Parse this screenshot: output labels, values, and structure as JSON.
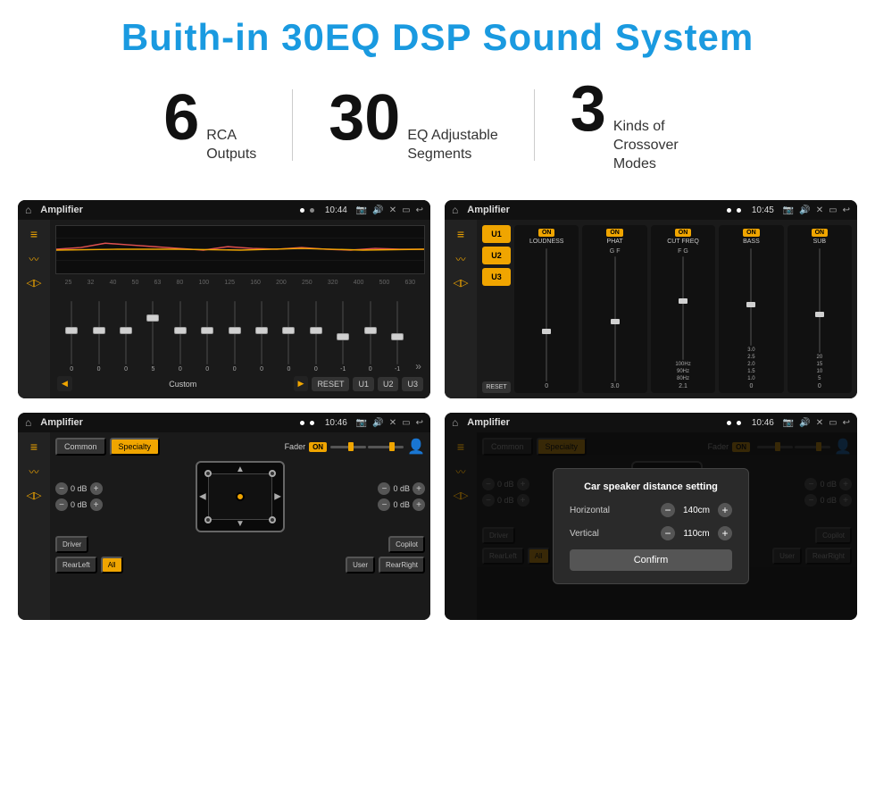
{
  "page": {
    "title": "Buith-in 30EQ DSP Sound System"
  },
  "stats": [
    {
      "number": "6",
      "label": "RCA\nOutputs"
    },
    {
      "number": "30",
      "label": "EQ Adjustable\nSegments"
    },
    {
      "number": "3",
      "label": "Kinds of\nCrossover Modes"
    }
  ],
  "screens": [
    {
      "id": "eq-screen",
      "title": "Amplifier",
      "time": "10:44",
      "type": "eq",
      "freqs": [
        "25",
        "32",
        "40",
        "50",
        "63",
        "80",
        "100",
        "125",
        "160",
        "200",
        "250",
        "320",
        "400",
        "500",
        "630"
      ],
      "values": [
        "0",
        "0",
        "0",
        "5",
        "0",
        "0",
        "0",
        "0",
        "0",
        "0",
        "-1",
        "0",
        "-1"
      ],
      "preset": "Custom",
      "buttons": [
        "RESET",
        "U1",
        "U2",
        "U3"
      ]
    },
    {
      "id": "crossover-screen",
      "title": "Amplifier",
      "time": "10:45",
      "type": "crossover",
      "channels": [
        "U1",
        "U2",
        "U3"
      ],
      "panels": [
        {
          "toggle": "ON",
          "title": "LOUDNESS"
        },
        {
          "toggle": "ON",
          "title": "PHAT"
        },
        {
          "toggle": "ON",
          "title": "CUT FREQ"
        },
        {
          "toggle": "ON",
          "title": "BASS"
        },
        {
          "toggle": "ON",
          "title": "SUB"
        }
      ]
    },
    {
      "id": "fader-screen",
      "title": "Amplifier",
      "time": "10:46",
      "type": "fader",
      "tabs": [
        "Common",
        "Specialty"
      ],
      "fader_label": "Fader",
      "fader_toggle": "ON",
      "db_values": [
        "0 dB",
        "0 dB",
        "0 dB",
        "0 dB"
      ],
      "labels": [
        "Driver",
        "Copilot",
        "RearLeft",
        "All",
        "User",
        "RearRight"
      ]
    },
    {
      "id": "dialog-screen",
      "title": "Amplifier",
      "time": "10:46",
      "type": "dialog",
      "tabs": [
        "Common",
        "Specialty"
      ],
      "dialog": {
        "title": "Car speaker distance setting",
        "fields": [
          {
            "label": "Horizontal",
            "value": "140cm"
          },
          {
            "label": "Vertical",
            "value": "110cm"
          }
        ],
        "confirm": "Confirm"
      },
      "db_values": [
        "0 dB",
        "0 dB"
      ],
      "labels": [
        "Driver",
        "Copilot",
        "RearLeft",
        "All",
        "User",
        "RearRight"
      ]
    }
  ],
  "colors": {
    "accent": "#f0a500",
    "title_blue": "#1a9ae0",
    "bg_dark": "#1a1a1a",
    "status_bar": "#111111"
  }
}
